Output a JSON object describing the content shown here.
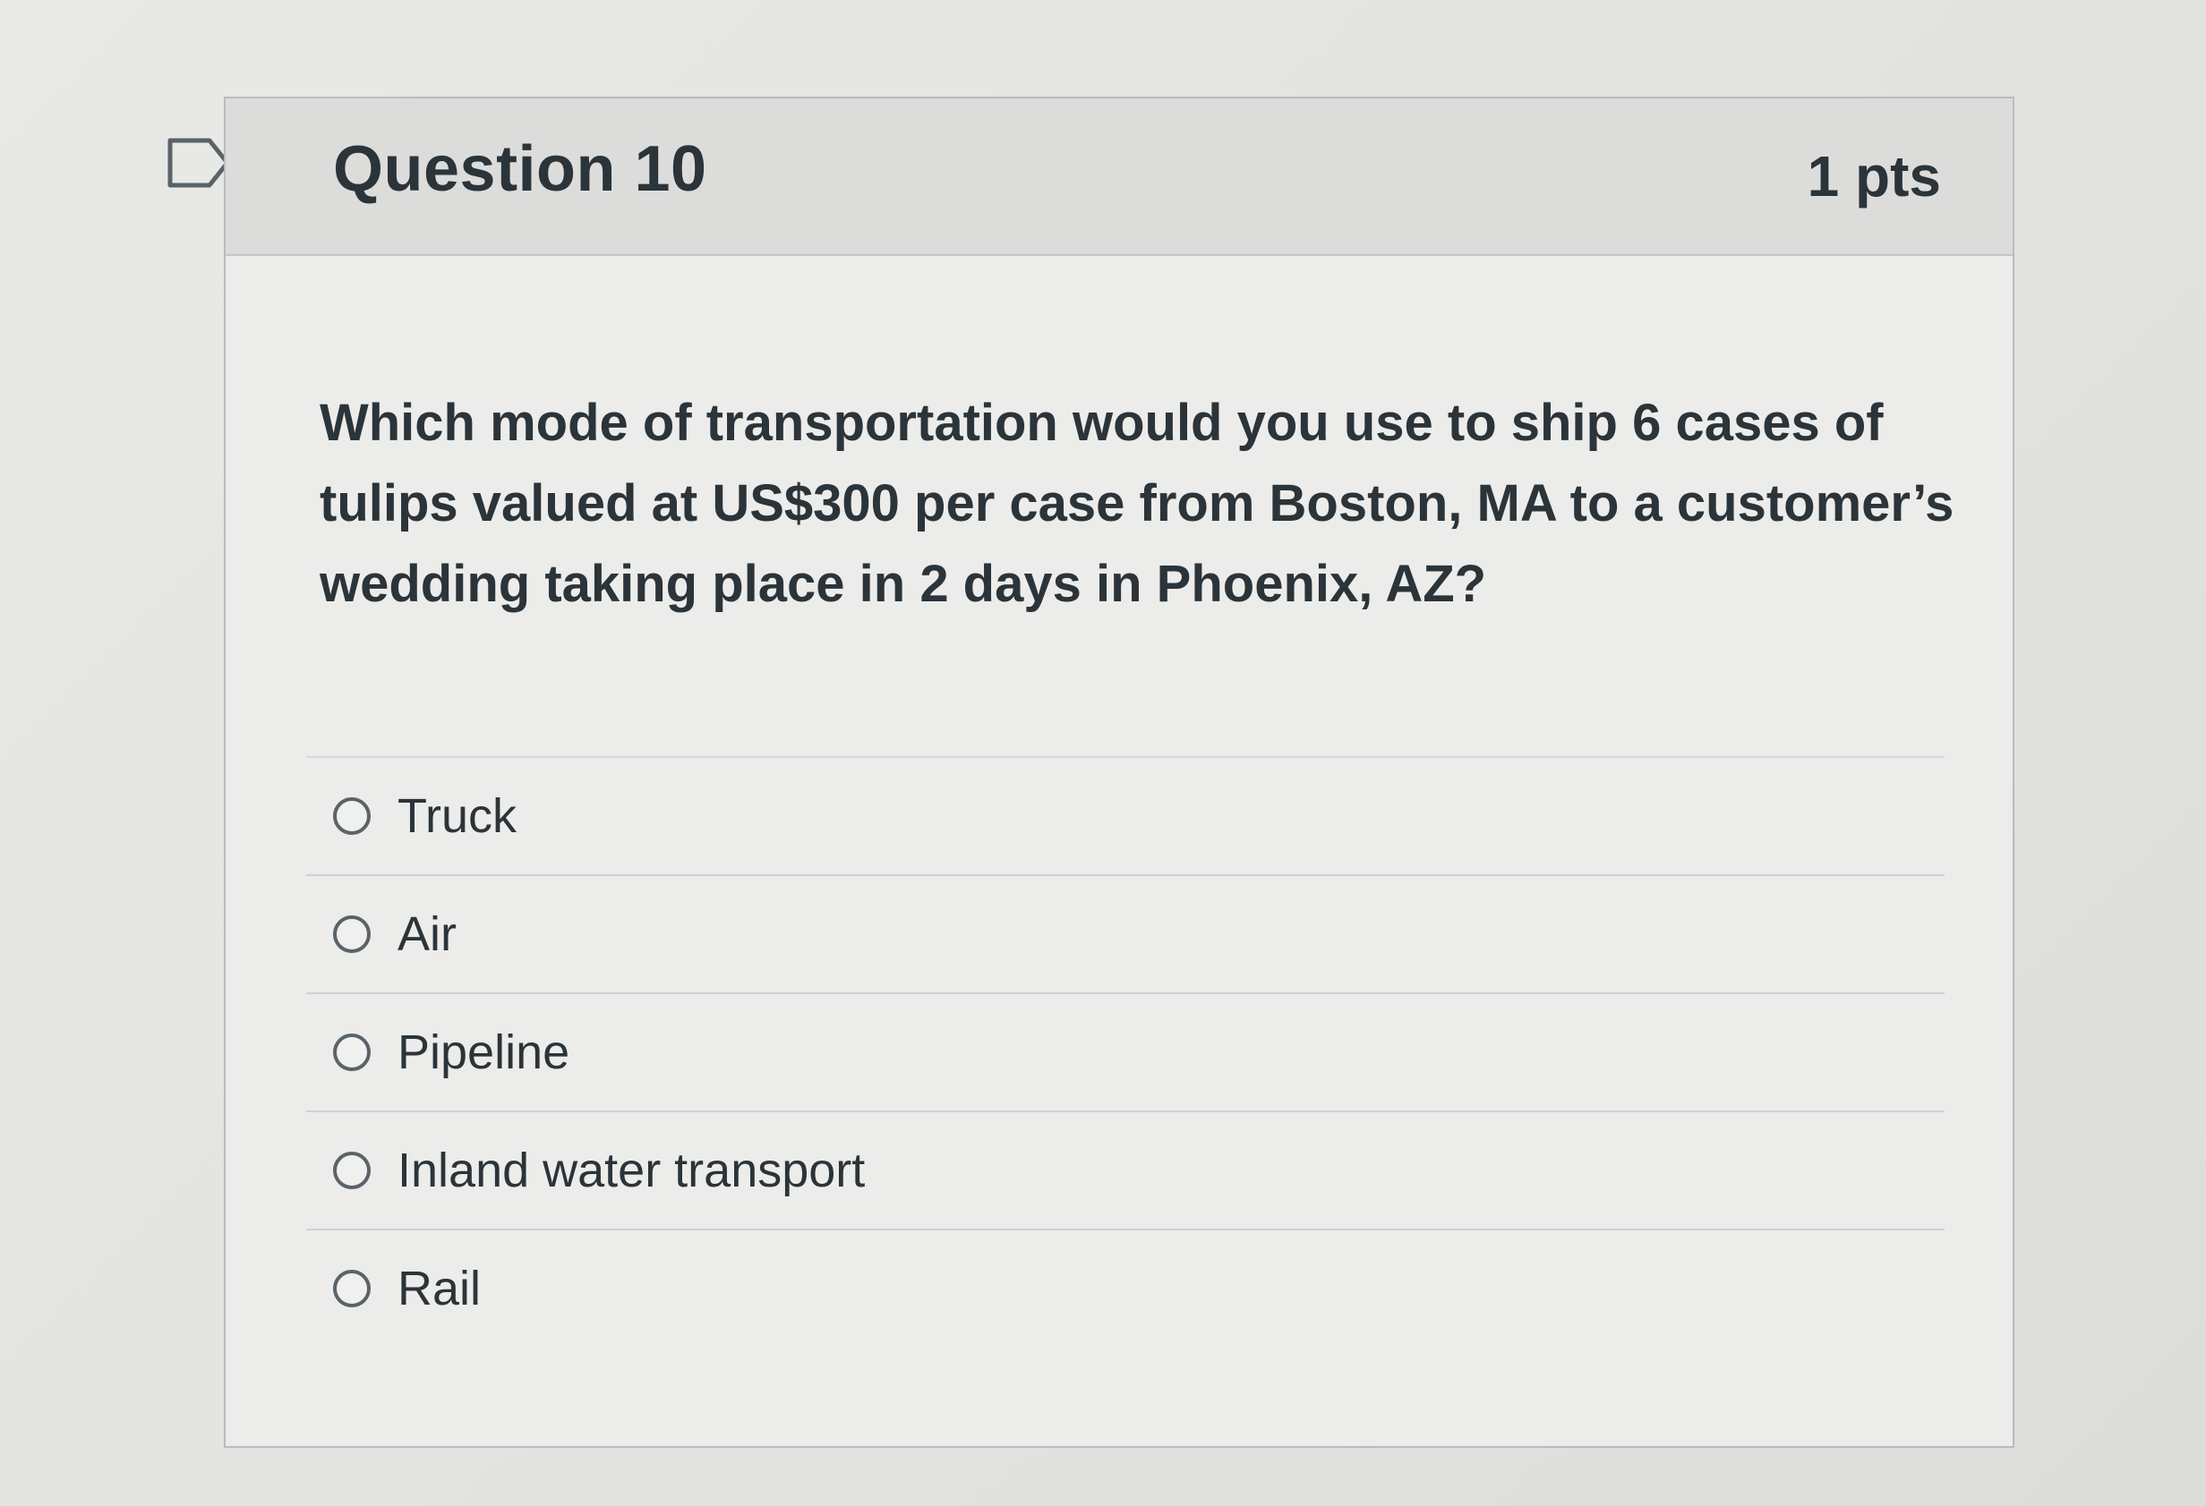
{
  "question": {
    "title": "Question 10",
    "points": "1 pts",
    "text": "Which mode of transportation would you use to ship 6 cases of tulips valued at US$300 per case from Boston, MA to a customer’s wedding taking place in 2 days in Phoenix, AZ?",
    "answers": [
      {
        "label": "Truck"
      },
      {
        "label": "Air"
      },
      {
        "label": "Pipeline"
      },
      {
        "label": "Inland water transport"
      },
      {
        "label": "Rail"
      }
    ]
  },
  "icons": {
    "bookmark": "bookmark-flag-icon",
    "radio": "radio-button-icon"
  },
  "colors": {
    "text": "#2b3439",
    "header_bg": "#dcdddb",
    "border": "#b9bcbe"
  }
}
